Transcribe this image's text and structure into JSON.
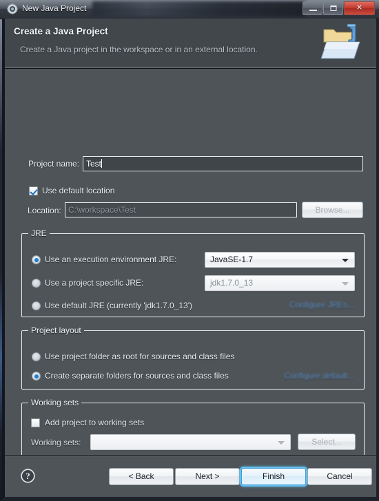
{
  "window": {
    "title": "New Java Project",
    "icon": "java-project-icon",
    "controls": {
      "minimize": "minimize-button",
      "maximize": "maximize-button",
      "close_label": "✕"
    }
  },
  "header": {
    "title": "Create a Java Project",
    "description": "Create a Java project in the workspace or in an external location.",
    "icon": "new-java-project-banner-icon"
  },
  "form": {
    "project_name_label": "Project name:",
    "project_name_value": "Test",
    "use_default_location_label": "Use default location",
    "use_default_location_checked": true,
    "location_label": "Location:",
    "location_value": "C:\\workspace\\Test",
    "browse_label": "Browse...",
    "browse_enabled": false
  },
  "jre": {
    "group_label": "JRE",
    "options": [
      {
        "id": "execution-environment",
        "label": "Use an execution environment JRE:",
        "selected": true,
        "combo_value": "JavaSE-1.7",
        "combo_enabled": true
      },
      {
        "id": "project-specific",
        "label": "Use a project specific JRE:",
        "selected": false,
        "combo_value": "jdk1.7.0_13",
        "combo_enabled": false
      },
      {
        "id": "default-jre",
        "label": "Use default JRE (currently 'jdk1.7.0_13')",
        "selected": false
      }
    ],
    "configure_link": "Configure JREs..."
  },
  "project_layout": {
    "group_label": "Project layout",
    "options": [
      {
        "id": "project-folder-root",
        "label": "Use project folder as root for sources and class files",
        "selected": false
      },
      {
        "id": "separate-folders",
        "label": "Create separate folders for sources and class files",
        "selected": true
      }
    ],
    "configure_link": "Configure default..."
  },
  "working_sets": {
    "group_label": "Working sets",
    "add_checkbox_label": "Add project to working sets",
    "add_checkbox_checked": false,
    "working_sets_label": "Working sets:",
    "working_sets_value": "",
    "select_label": "Select...",
    "select_enabled": false
  },
  "footer": {
    "help_icon": "help-icon",
    "back_label": "< Back",
    "next_label": "Next >",
    "finish_label": "Finish",
    "cancel_label": "Cancel"
  },
  "colors": {
    "window_bg": "#4e5458",
    "header_bg": "#41474b",
    "accent_blue": "#1d7fd4",
    "link_blue": "#5e8ec4",
    "focus_glow": "#63c2f2",
    "close_red": "#c2392e"
  }
}
